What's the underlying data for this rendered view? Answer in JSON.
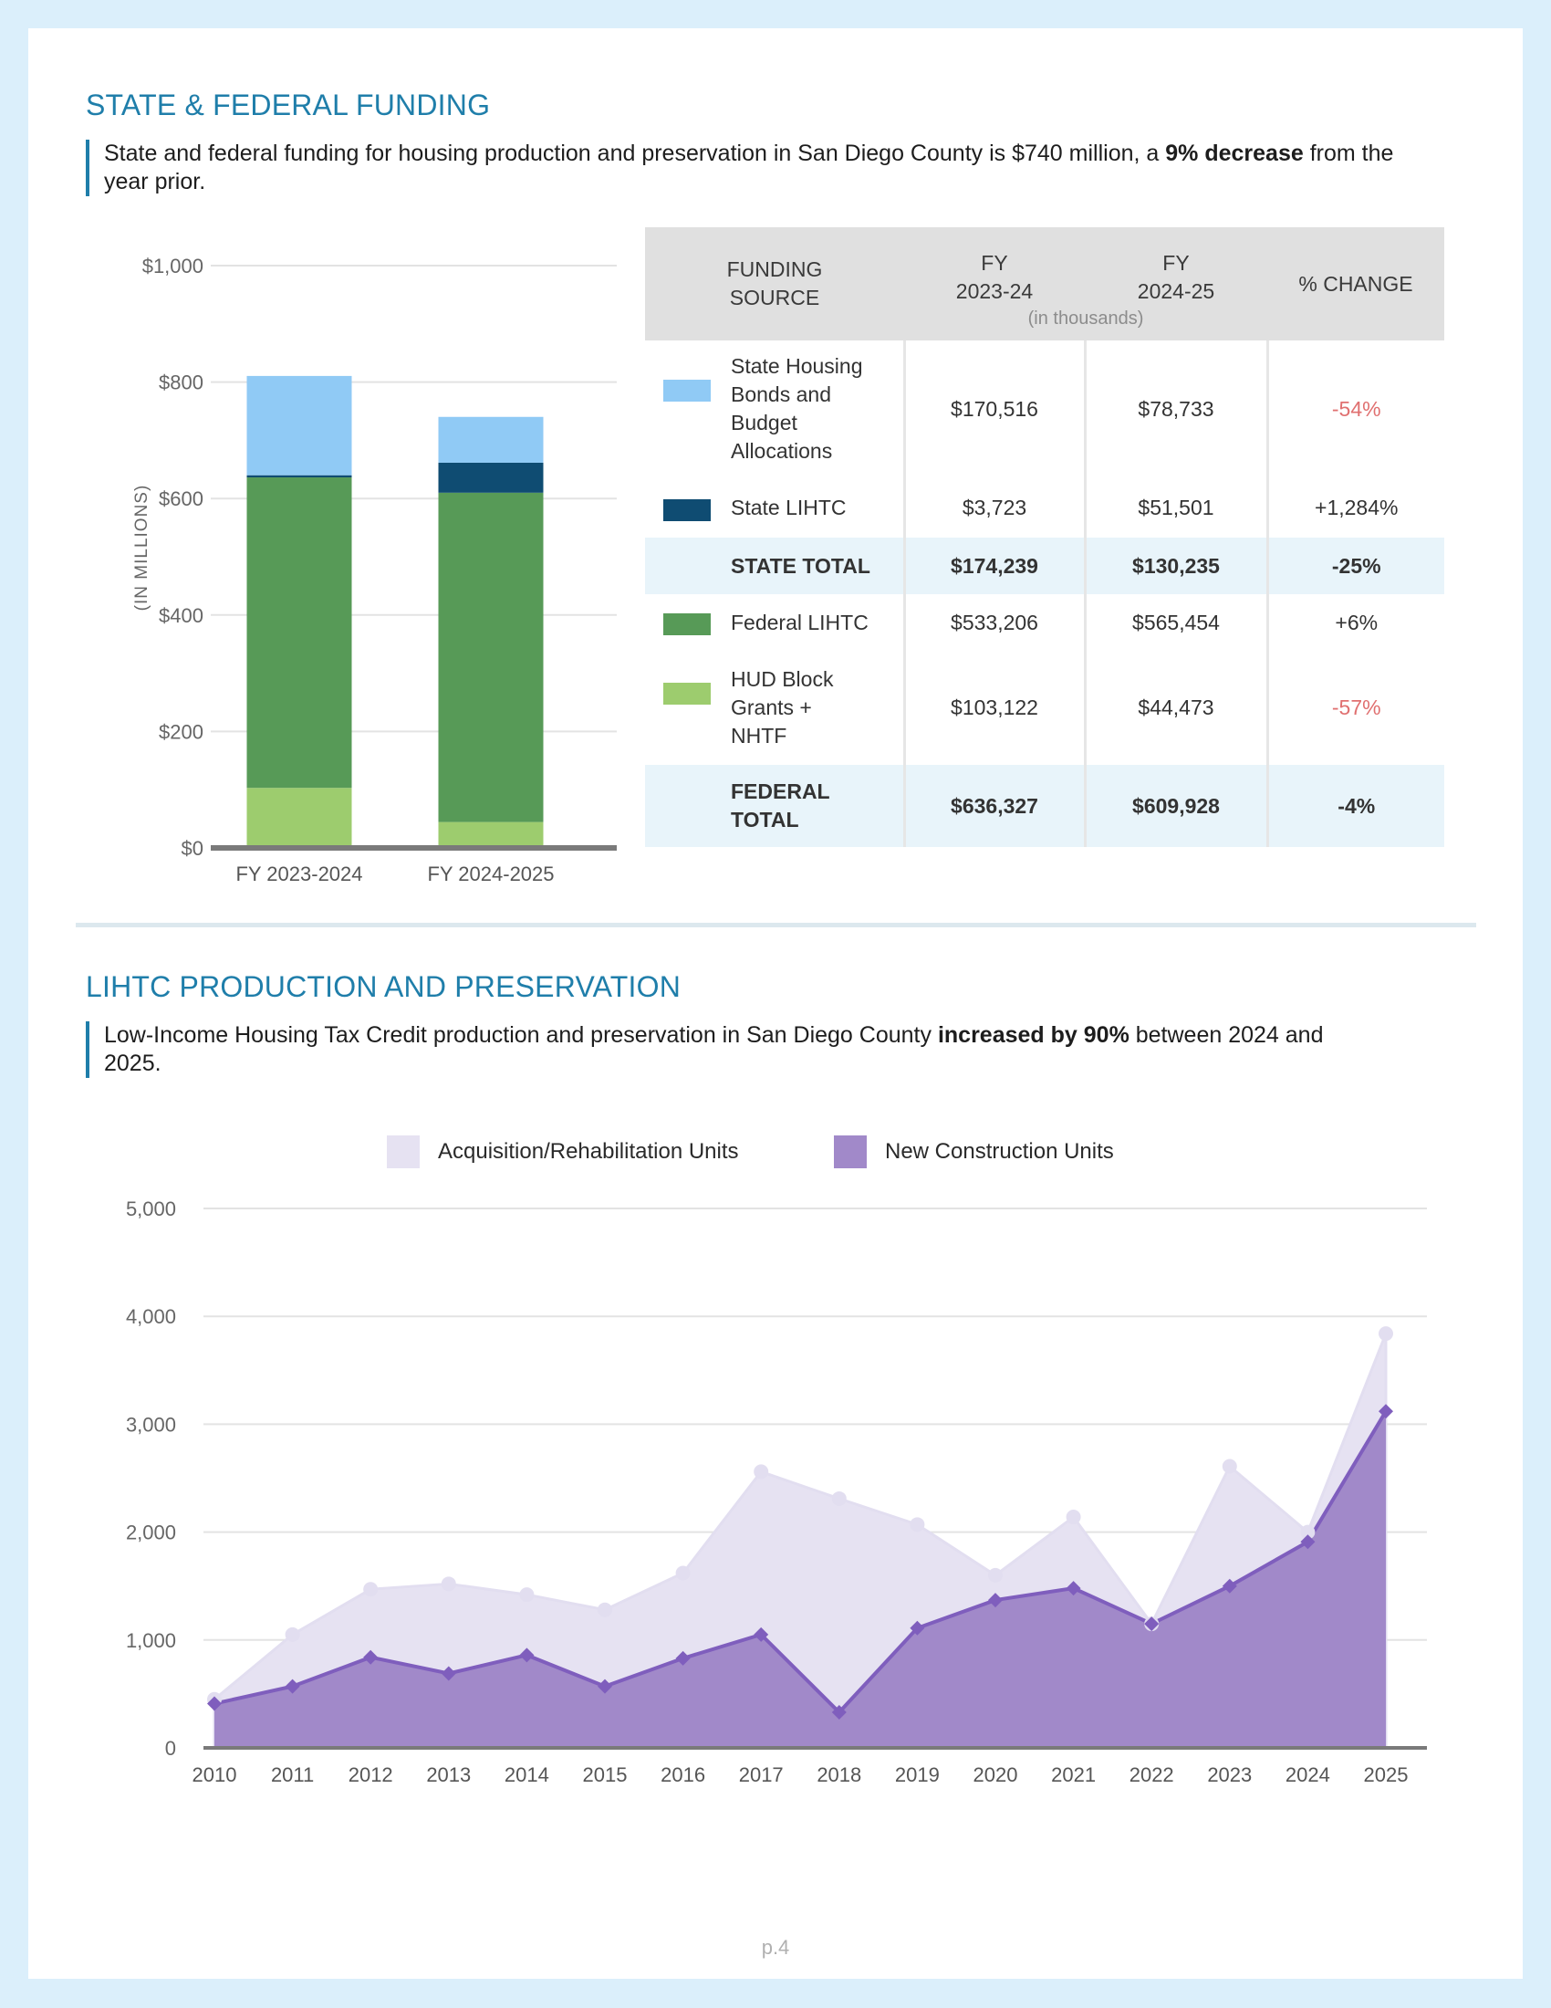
{
  "section1": {
    "title": "STATE & FEDERAL FUNDING",
    "callout_pre": "State and federal funding for housing production and preservation in San Diego County is $740 million, a ",
    "callout_bold": "9% decrease",
    "callout_post": " from the year prior."
  },
  "table": {
    "headers": {
      "source": "FUNDING SOURCE",
      "fy1_a": "FY",
      "fy1_b": "2023-24",
      "fy2_a": "FY",
      "fy2_b": "2024-25",
      "change": "% CHANGE",
      "unit_note": "(in thousands)"
    },
    "rows": [
      {
        "label": "State Housing Bonds and Budget Allocations",
        "swatch": "#90caf5",
        "fy1": "$170,516",
        "fy2": "$78,733",
        "change": "-54%",
        "neg": true,
        "total": false
      },
      {
        "label": "State LIHTC",
        "swatch": "#0f4c72",
        "fy1": "$3,723",
        "fy2": "$51,501",
        "change": "+1,284%",
        "neg": false,
        "total": false
      },
      {
        "label": "STATE TOTAL",
        "swatch": "",
        "fy1": "$174,239",
        "fy2": "$130,235",
        "change": "-25%",
        "neg": true,
        "total": true
      },
      {
        "label": "Federal LIHTC",
        "swatch": "#579a57",
        "fy1": "$533,206",
        "fy2": "$565,454",
        "change": "+6%",
        "neg": false,
        "total": false
      },
      {
        "label": "HUD Block Grants + NHTF",
        "swatch": "#9dcc6e",
        "fy1": "$103,122",
        "fy2": "$44,473",
        "change": "-57%",
        "neg": true,
        "total": false
      },
      {
        "label": "FEDERAL TOTAL",
        "swatch": "",
        "fy1": "$636,327",
        "fy2": "$609,928",
        "change": "-4%",
        "neg": true,
        "total": true
      }
    ]
  },
  "section2": {
    "title": "LIHTC PRODUCTION AND PRESERVATION",
    "callout_pre": "Low-Income Housing Tax Credit production and preservation in San Diego County ",
    "callout_bold": "increased by 90%",
    "callout_post": " between 2024 and 2025."
  },
  "page_number": "p.4",
  "chart_data": [
    {
      "type": "bar",
      "stacked": true,
      "categories": [
        "FY 2023-2024",
        "FY 2024-2025"
      ],
      "ylabel": "(IN MILLIONS)",
      "ylim": [
        0,
        1000
      ],
      "yticks": [
        0,
        200,
        400,
        600,
        800,
        1000
      ],
      "ytick_labels": [
        "$0",
        "$200",
        "$400",
        "$600",
        "$800",
        "$1,000"
      ],
      "grid": true,
      "series": [
        {
          "key": "hud",
          "color": "#9dcc6e",
          "values": [
            103.1,
            44.5
          ]
        },
        {
          "key": "federal_lihtc",
          "color": "#579a57",
          "values": [
            533.2,
            565.5
          ]
        },
        {
          "key": "state_lihtc",
          "color": "#0f4c72",
          "values": [
            3.7,
            51.5
          ]
        },
        {
          "key": "state_bonds",
          "color": "#90caf5",
          "values": [
            170.5,
            78.7
          ]
        }
      ]
    },
    {
      "type": "area",
      "x": [
        2010,
        2011,
        2012,
        2013,
        2014,
        2015,
        2016,
        2017,
        2018,
        2019,
        2020,
        2021,
        2022,
        2023,
        2024,
        2025
      ],
      "ylim": [
        0,
        5000
      ],
      "yticks": [
        0,
        1000,
        2000,
        3000,
        4000,
        5000
      ],
      "ytick_labels": [
        "0",
        "1,000",
        "2,000",
        "3,000",
        "4,000",
        "5,000"
      ],
      "grid": true,
      "legend_position": "top-center",
      "series": [
        {
          "name": "Acquisition/Rehabilitation Units",
          "kind": "total",
          "color": "#e6e2f2",
          "marker_color": "#e2def0",
          "values": [
            450,
            1050,
            1470,
            1520,
            1420,
            1280,
            1620,
            2560,
            2310,
            2070,
            1600,
            2140,
            1150,
            2610,
            2000,
            3840
          ]
        },
        {
          "name": "New Construction Units",
          "kind": "new",
          "color": "#a189c9",
          "line_color": "#7f5ebd",
          "values": [
            410,
            570,
            840,
            690,
            860,
            570,
            830,
            1050,
            330,
            1110,
            1370,
            1480,
            1150,
            1500,
            1910,
            3120
          ]
        }
      ]
    }
  ]
}
